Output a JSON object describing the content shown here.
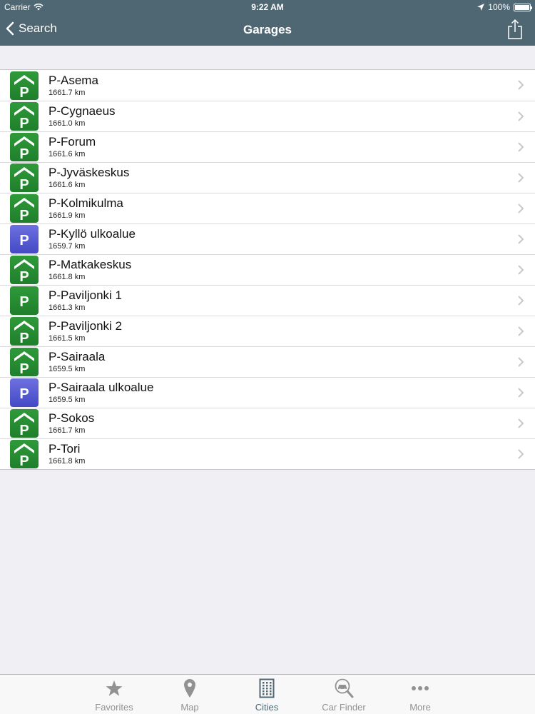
{
  "status_bar": {
    "carrier": "Carrier",
    "time": "9:22 AM",
    "battery": "100%"
  },
  "nav": {
    "back_label": "Search",
    "title": "Garages"
  },
  "garages": [
    {
      "name": "P-Asema",
      "distance": "1661.7 km",
      "icon": "parking-garage-icon",
      "color": "green"
    },
    {
      "name": "P-Cygnaeus",
      "distance": "1661.0 km",
      "icon": "parking-garage-icon",
      "color": "green"
    },
    {
      "name": "P-Forum",
      "distance": "1661.6 km",
      "icon": "parking-garage-icon",
      "color": "green"
    },
    {
      "name": "P-Jyväskeskus",
      "distance": "1661.6 km",
      "icon": "parking-garage-icon",
      "color": "green"
    },
    {
      "name": "P-Kolmikulma",
      "distance": "1661.9 km",
      "icon": "parking-garage-icon",
      "color": "green"
    },
    {
      "name": "P-Kyllö ulkoalue",
      "distance": "1659.7 km",
      "icon": "parking-outdoor-icon",
      "color": "blue"
    },
    {
      "name": "P-Matkakeskus",
      "distance": "1661.8 km",
      "icon": "parking-garage-icon",
      "color": "green"
    },
    {
      "name": "P-Paviljonki 1",
      "distance": "1661.3 km",
      "icon": "parking-icon",
      "color": "green"
    },
    {
      "name": "P-Paviljonki 2",
      "distance": "1661.5 km",
      "icon": "parking-garage-icon",
      "color": "green"
    },
    {
      "name": "P-Sairaala",
      "distance": "1659.5 km",
      "icon": "parking-garage-icon",
      "color": "green"
    },
    {
      "name": "P-Sairaala ulkoalue",
      "distance": "1659.5 km",
      "icon": "parking-outdoor-icon",
      "color": "blue"
    },
    {
      "name": "P-Sokos",
      "distance": "1661.7 km",
      "icon": "parking-garage-icon",
      "color": "green"
    },
    {
      "name": "P-Tori",
      "distance": "1661.8 km",
      "icon": "parking-garage-icon",
      "color": "green"
    }
  ],
  "tabs": [
    {
      "label": "Favorites",
      "icon": "star-icon",
      "active": false
    },
    {
      "label": "Map",
      "icon": "map-pin-icon",
      "active": false
    },
    {
      "label": "Cities",
      "icon": "building-icon",
      "active": true
    },
    {
      "label": "Car Finder",
      "icon": "car-finder-icon",
      "active": false
    },
    {
      "label": "More",
      "icon": "more-icon",
      "active": false
    }
  ],
  "colors": {
    "nav_background": "#4f6773",
    "garage_green": "#2a8f35",
    "outdoor_blue": "#5a5ed8",
    "tab_active": "#4f6773",
    "tab_inactive": "#929292"
  }
}
